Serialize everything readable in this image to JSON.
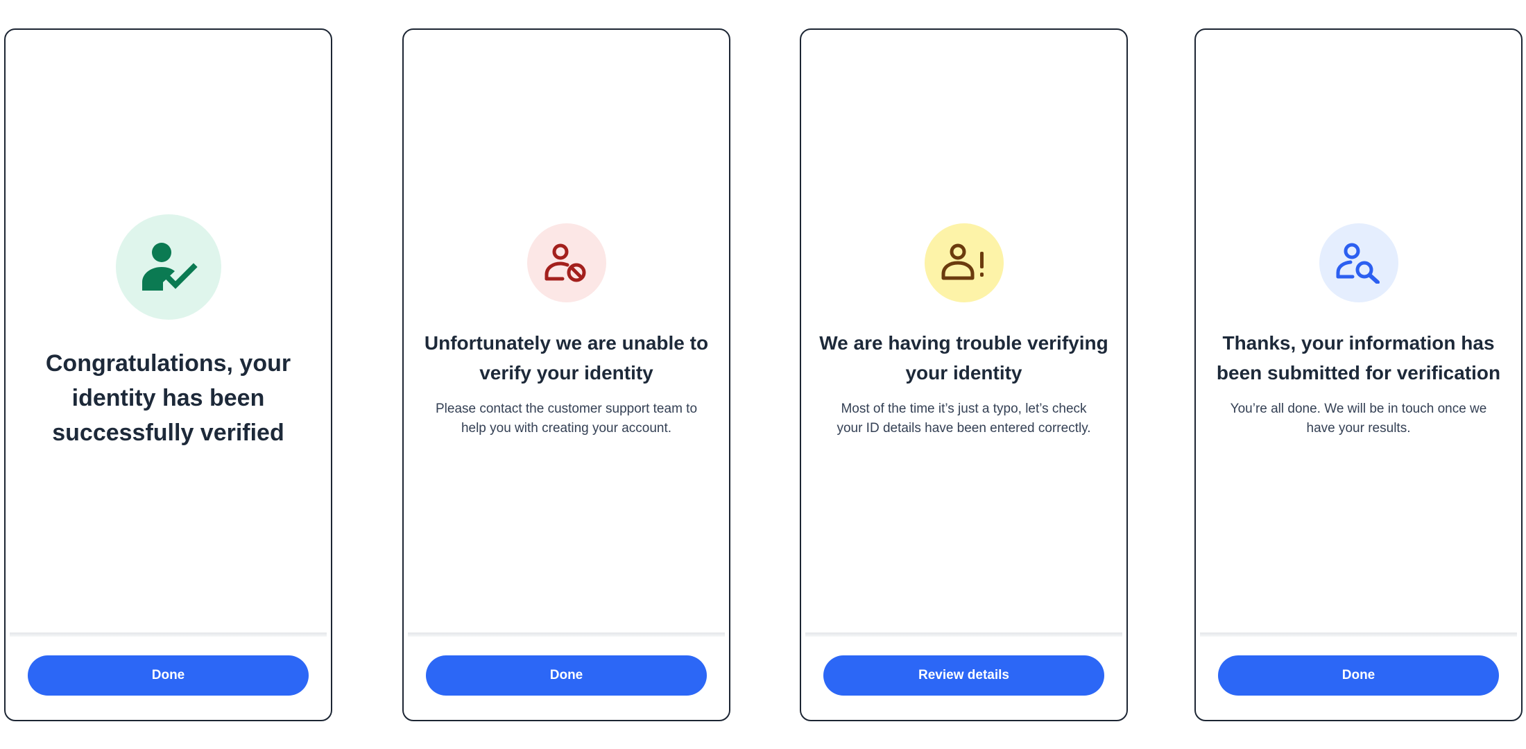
{
  "screens": [
    {
      "status": "verified",
      "icon": "user-check-icon",
      "icon_color": "#0b7a52",
      "icon_bg": "#dff5ec",
      "title": "Congratulations, your identity has been successfully verified",
      "body": "",
      "button_label": "Done"
    },
    {
      "status": "rejected",
      "icon": "user-blocked-icon",
      "icon_color": "#a3201d",
      "icon_bg": "#fce7e6",
      "title": "Unfortunately we are unable to verify your identity",
      "body": "Please contact the customer support team to help you with creating your account.",
      "button_label": "Done"
    },
    {
      "status": "trouble",
      "icon": "user-alert-icon",
      "icon_color": "#6b3b0e",
      "icon_bg": "#fdf3a8",
      "title": "We are having trouble verifying your identity",
      "body": "Most of the time it’s just a typo, let’s check your ID details have been entered correctly.",
      "button_label": "Review details"
    },
    {
      "status": "submitted",
      "icon": "user-search-icon",
      "icon_color": "#2c5ff0",
      "icon_bg": "#e5eefe",
      "title": "Thanks, your information has been submitted for verification",
      "body": "You’re all done. We will be in touch once we have your results.",
      "button_label": "Done"
    }
  ],
  "colors": {
    "button_bg": "#2c67f6",
    "button_text": "#ffffff",
    "card_border": "#1c2533",
    "heading": "#1d2939",
    "body": "#344054"
  }
}
